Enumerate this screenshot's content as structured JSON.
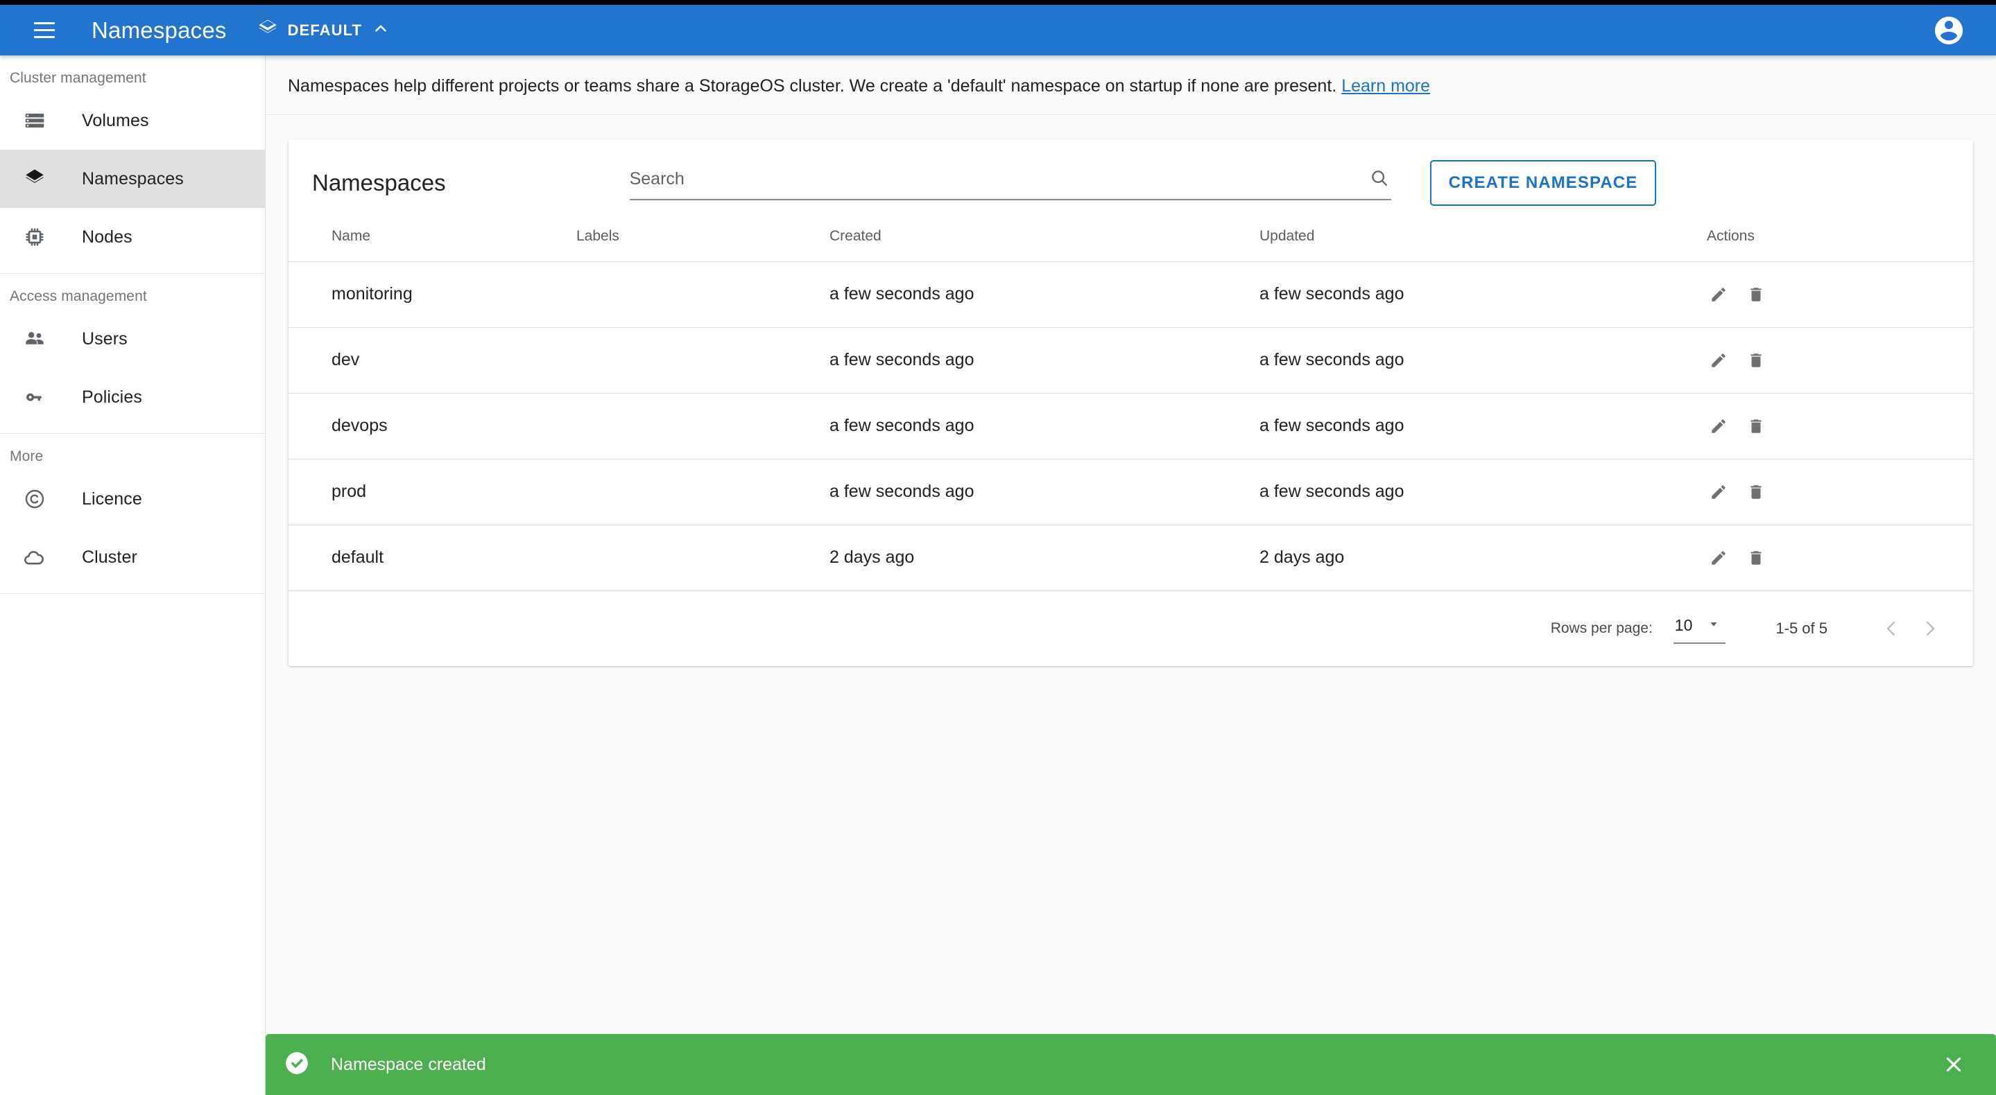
{
  "appbar": {
    "menu_icon": "hamburger-menu-icon",
    "title": "Namespaces",
    "namespace_selector": {
      "icon": "layers-icon",
      "label": "DEFAULT",
      "chevron": "chevron-up-icon"
    },
    "account_icon": "account-circle-icon",
    "background_color": "#2374ce"
  },
  "sidebar": {
    "sections": [
      {
        "label": "Cluster management",
        "items": [
          {
            "label": "Volumes",
            "icon": "storage-icon",
            "active": false
          },
          {
            "label": "Namespaces",
            "icon": "layers-icon",
            "active": true
          },
          {
            "label": "Nodes",
            "icon": "cpu-chip-icon",
            "active": false
          }
        ]
      },
      {
        "label": "Access management",
        "items": [
          {
            "label": "Users",
            "icon": "people-icon",
            "active": false
          },
          {
            "label": "Policies",
            "icon": "key-icon",
            "active": false
          }
        ]
      },
      {
        "label": "More",
        "items": [
          {
            "label": "Licence",
            "icon": "copyright-icon",
            "active": false
          },
          {
            "label": "Cluster",
            "icon": "cloud-icon",
            "active": false
          }
        ]
      }
    ]
  },
  "info_banner": {
    "text": "Namespaces help different projects or teams share a StorageOS cluster. We create a 'default' namespace on startup if none are present.",
    "link_label": "Learn more"
  },
  "card": {
    "title": "Namespaces",
    "search": {
      "placeholder": "Search",
      "value": "",
      "icon": "search-icon"
    },
    "create_button": "CREATE NAMESPACE",
    "table": {
      "columns": [
        "Name",
        "Labels",
        "Created",
        "Updated",
        "Actions"
      ],
      "rows": [
        {
          "name": "monitoring",
          "labels": "",
          "created": "a few seconds ago",
          "updated": "a few seconds ago"
        },
        {
          "name": "dev",
          "labels": "",
          "created": "a few seconds ago",
          "updated": "a few seconds ago"
        },
        {
          "name": "devops",
          "labels": "",
          "created": "a few seconds ago",
          "updated": "a few seconds ago"
        },
        {
          "name": "prod",
          "labels": "",
          "created": "a few seconds ago",
          "updated": "a few seconds ago"
        },
        {
          "name": "default",
          "labels": "",
          "created": "2 days ago",
          "updated": "2 days ago"
        }
      ],
      "row_actions": {
        "edit_icon": "pencil-edit-icon",
        "delete_icon": "trash-delete-icon"
      }
    },
    "paginator": {
      "rows_per_page_label": "Rows per page:",
      "rows_per_page_value": "10",
      "dropdown_icon": "arrow-drop-down-icon",
      "range_label": "1-5 of 5",
      "prev_icon": "chevron-left-icon",
      "next_icon": "chevron-right-icon"
    }
  },
  "snackbar": {
    "icon": "check-circle-icon",
    "message": "Namespace created",
    "close_icon": "close-icon",
    "background_color": "#4caf50"
  }
}
